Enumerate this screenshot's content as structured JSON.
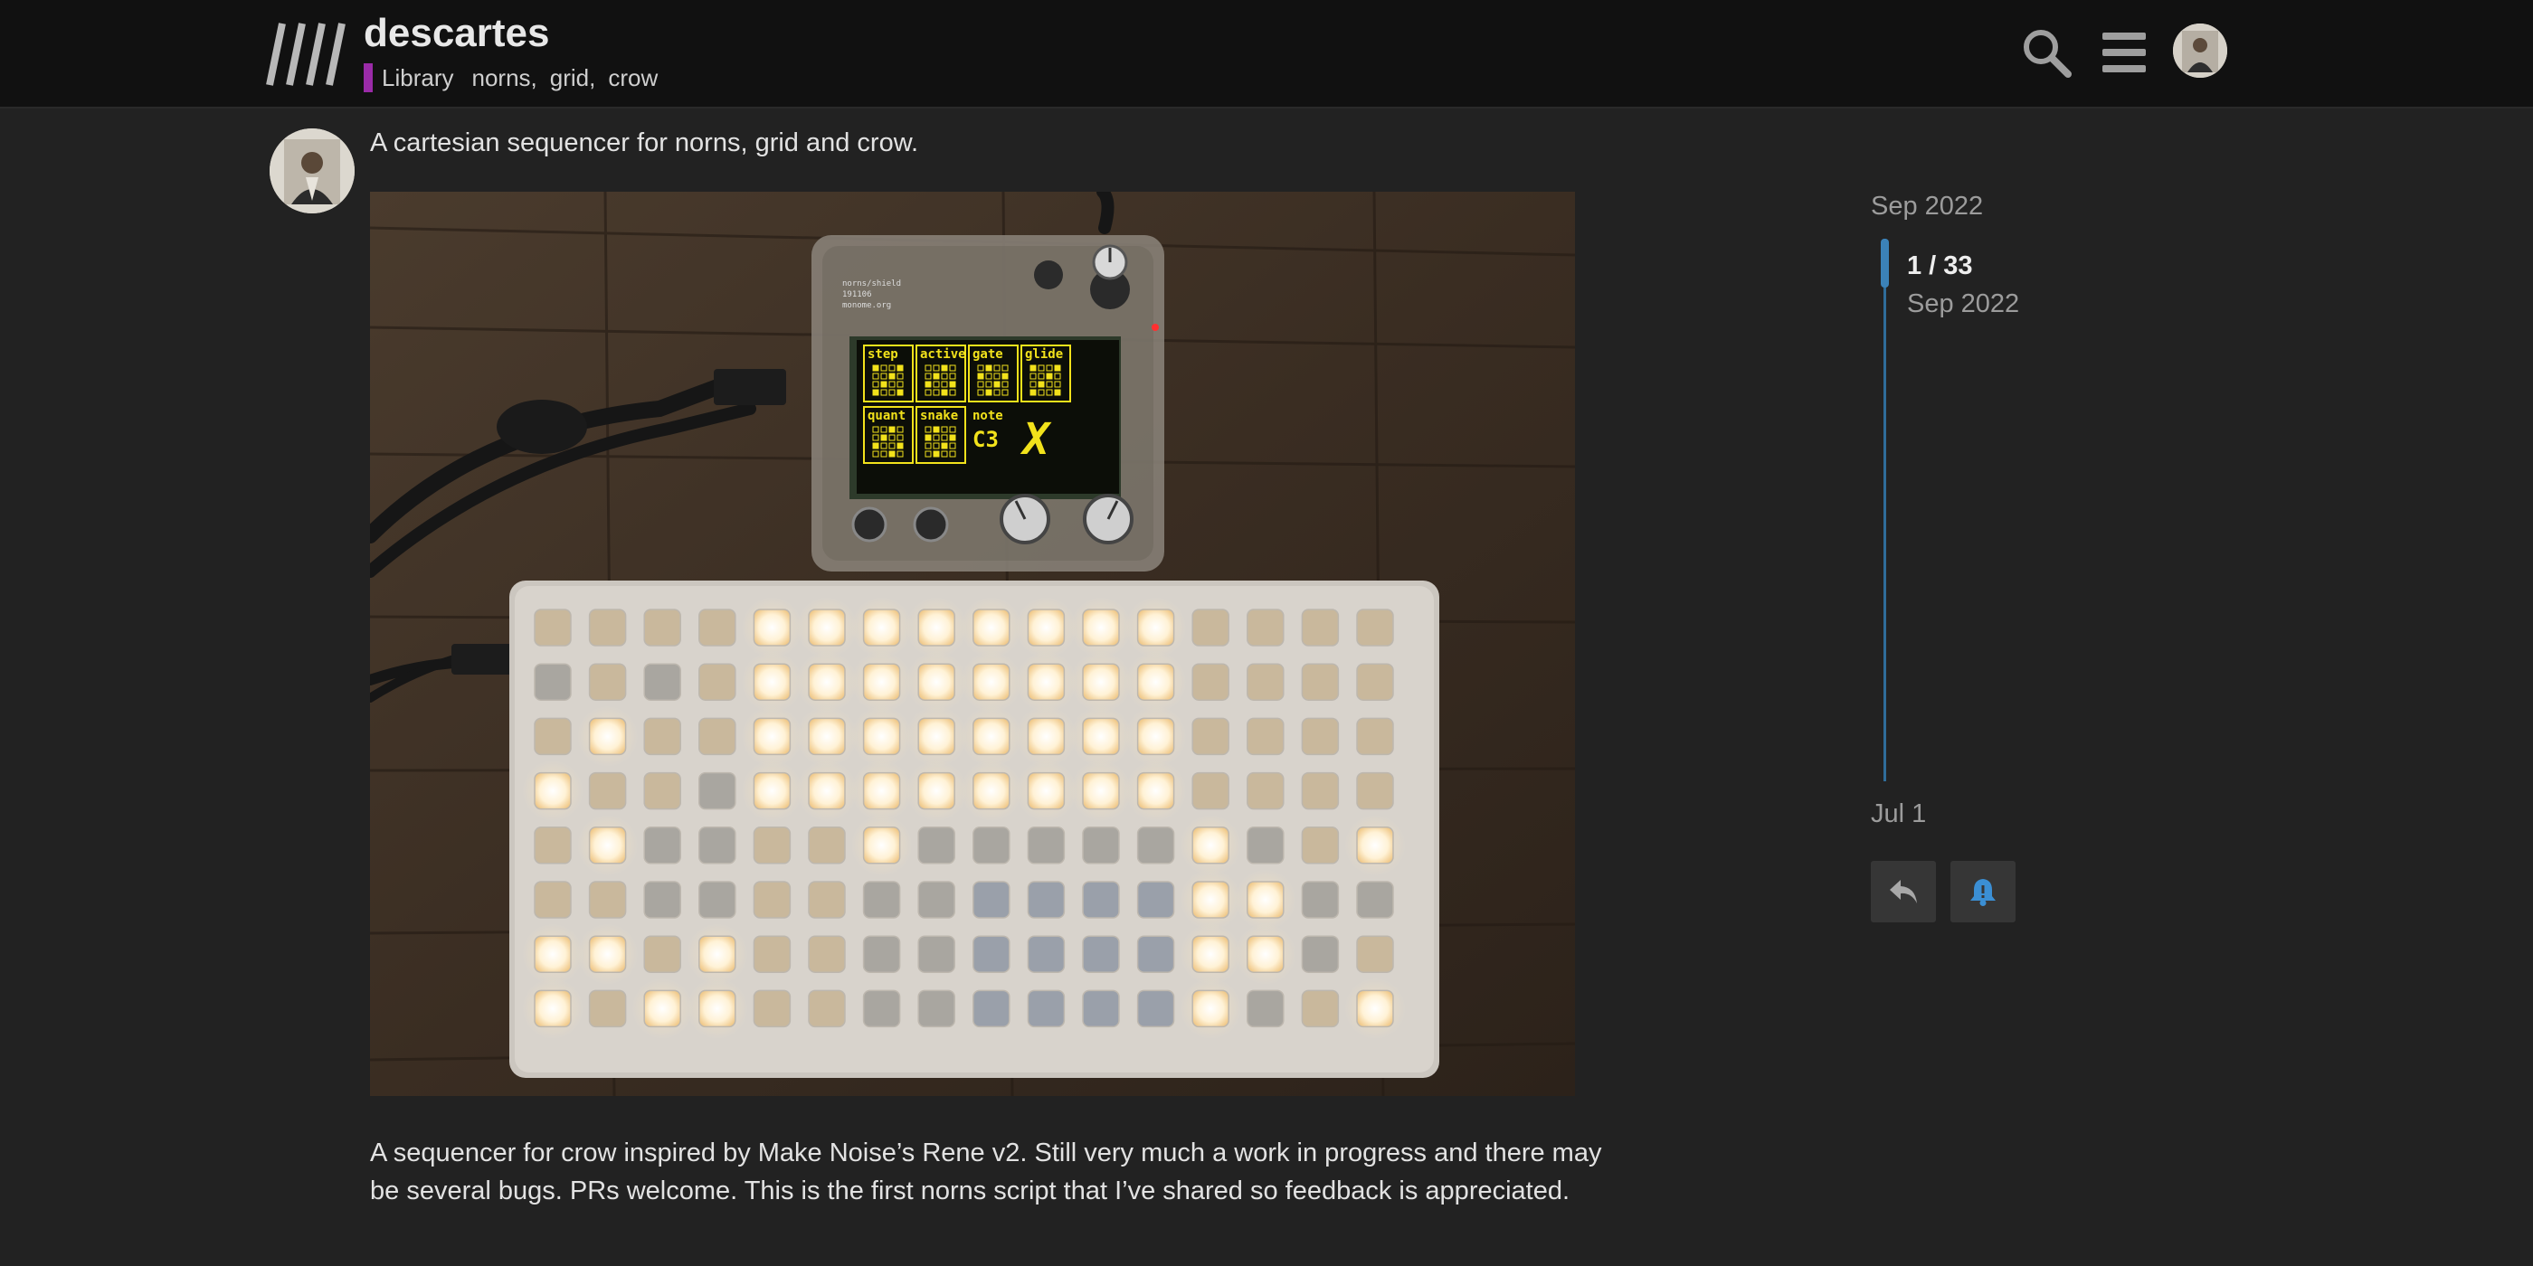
{
  "header": {
    "topic_title": "descartes",
    "category": "Library",
    "category_color": "#9a2ba8",
    "tags": [
      "norns",
      "grid",
      "crow"
    ],
    "tag_separator": ",",
    "icons": [
      "site-logo",
      "search-icon",
      "hamburger-menu-icon",
      "user-avatar"
    ]
  },
  "post": {
    "intro": "A cartesian sequencer for norns, grid and crow.",
    "body": "A sequencer for crow inspired by Make Noise’s Rene v2. Still very much a work in progress and there may be several bugs. PRs welcome. This is the first norns script that I’ve shared so feedback is appreciated.",
    "screen_pages": [
      "step",
      "active",
      "gate",
      "glide",
      "quant",
      "snake",
      "note"
    ],
    "screen_note_value": "C3",
    "screen_mark": "X",
    "grid_columns": 16,
    "grid_rows": 8
  },
  "timeline": {
    "start_date": "Sep 2022",
    "counter": "1 / 33",
    "current_date": "Sep 2022",
    "end_date": "Jul 1",
    "accent_color": "#3b82b8"
  },
  "actions": {
    "reply_icon": "reply-icon",
    "notify_icon": "bell-icon"
  }
}
